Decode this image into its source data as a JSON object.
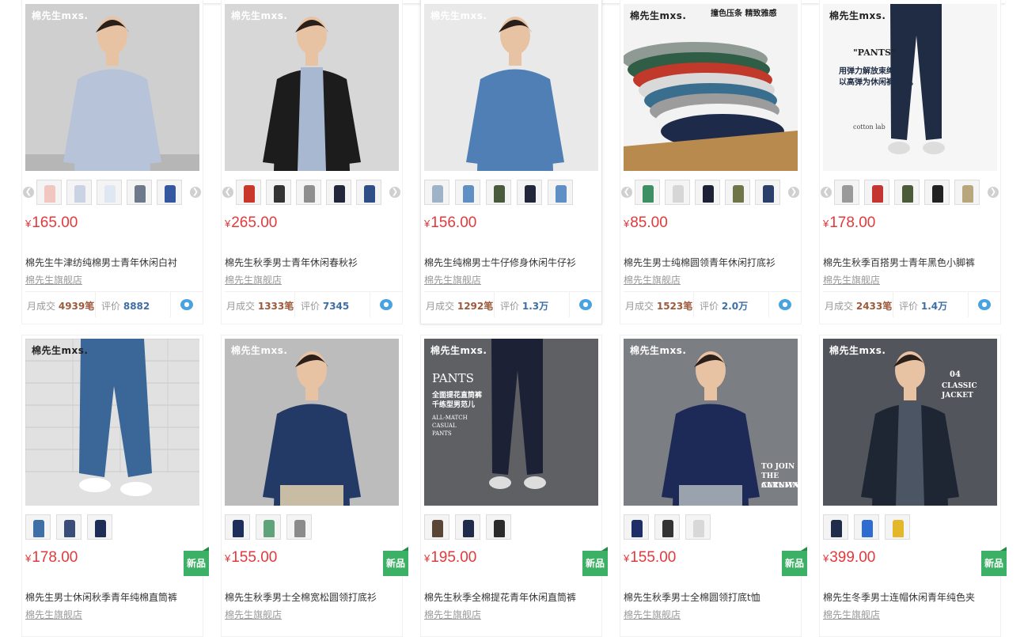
{
  "currency": "¥",
  "new_badge": "新品",
  "sales_label": "月成交",
  "sales_unit": "笔",
  "review_label": "评价",
  "products": [
    {
      "price": "165.00",
      "title": "棉先生牛津纺纯棉男士青年休闲白衬",
      "shop": "棉先生旗舰店",
      "sales": "4939",
      "reviews": "8882"
    },
    {
      "price": "265.00",
      "title": "棉先生秋季男士青年休闲春秋衫",
      "shop": "棉先生旗舰店",
      "sales": "1333",
      "reviews": "7345"
    },
    {
      "price": "156.00",
      "title": "棉先生纯棉男士牛仔修身休闲牛仔衫",
      "shop": "棉先生旗舰店",
      "sales": "1292",
      "reviews": "1.3万"
    },
    {
      "price": "85.00",
      "title": "棉先生男士纯棉圆领青年休闲打底衫",
      "shop": "棉先生旗舰店",
      "sales": "1523",
      "reviews": "2.0万"
    },
    {
      "price": "178.00",
      "title": "棉先生秋季百搭男士青年黑色小脚裤",
      "shop": "棉先生旗舰店",
      "sales": "2433",
      "reviews": "1.4万"
    },
    {
      "price": "178.00",
      "title": "棉先生男士休闲秋季青年纯棉直筒裤",
      "shop": "棉先生旗舰店"
    },
    {
      "price": "155.00",
      "title": "棉先生秋季男士全棉宽松圆领打底衫",
      "shop": "棉先生旗舰店"
    },
    {
      "price": "195.00",
      "title": "棉先生秋季全棉提花青年休闲直筒裤",
      "shop": "棉先生旗舰店"
    },
    {
      "price": "155.00",
      "title": "棉先生秋季男士全棉圆领打底t恤",
      "shop": "棉先生旗舰店"
    },
    {
      "price": "399.00",
      "title": "棉先生冬季男士连帽休闲青年纯色夹",
      "shop": "棉先生旗舰店"
    }
  ],
  "image_text": {
    "brand": "棉先生mxs.",
    "p4_heading": "撞色压条 精致雅感",
    "p5_pants": "\"PANTS\"",
    "p5_caption1": "用弹力解放束缚，",
    "p5_caption2": "以高弹为休闲裤正名。",
    "p5_footer": "cotton lab",
    "p8_pants": "PANTS",
    "p8_cn1": "全面提花直筒裤",
    "p8_cn2": "千练型男范儿",
    "p8_en1": "ALL-MATCH",
    "p8_en2": "CASUAL",
    "p8_en3": "PANTS",
    "p9_en1": "TO JOIN",
    "p9_en2": "THE AUTUMN",
    "p9_en3": "CARNIVAL",
    "p10_num": "04",
    "p10_en": "CLASSIC JACKET"
  },
  "colors": {
    "price": "#e4393c",
    "new_badge": "#3cb064",
    "sales_value": "#9c5a3c",
    "review_value": "#3d6ea5",
    "wangwang": "#4aa3df"
  }
}
